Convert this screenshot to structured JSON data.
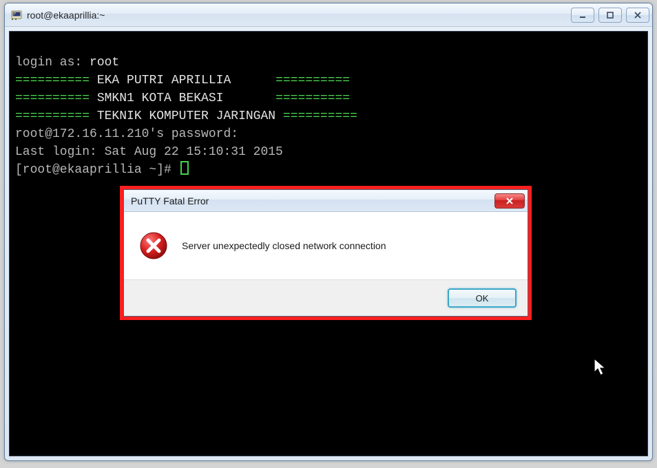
{
  "window": {
    "title": "root@ekaaprillia:~"
  },
  "terminal": {
    "line1_label": "login as: ",
    "line1_value": "root",
    "banner_eq_left": "==========",
    "banner_eq_right": "==========",
    "banner1": " EKA PUTRI APRILLIA      ",
    "banner2": " SMKN1 KOTA BEKASI       ",
    "banner3": " TEKNIK KOMPUTER JARINGAN ",
    "pass_prompt": "root@172.16.11.210's password:",
    "last_login": "Last login: Sat Aug 22 15:10:31 2015",
    "prompt": "[root@ekaaprillia ~]# "
  },
  "dialog": {
    "title": "PuTTY Fatal Error",
    "message": "Server unexpectedly closed network connection",
    "ok_label": "OK"
  }
}
